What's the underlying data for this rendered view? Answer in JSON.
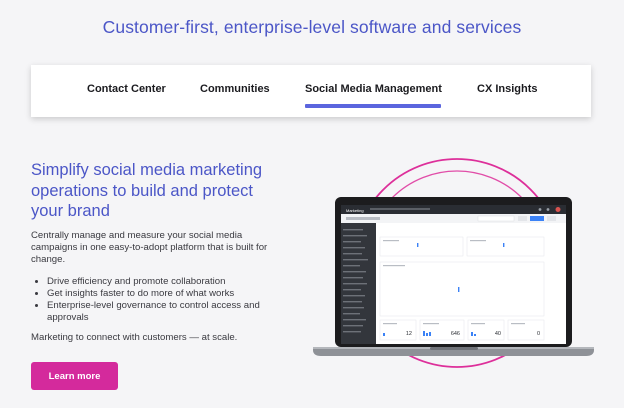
{
  "headline": "Customer-first, enterprise-level software and services",
  "tabs": [
    {
      "label": "Contact Center",
      "active": false
    },
    {
      "label": "Communities",
      "active": false
    },
    {
      "label": "Social Media Management",
      "active": true
    },
    {
      "label": "CX Insights",
      "active": false
    }
  ],
  "content": {
    "subhead_lines": [
      "Simplify social media marketing",
      "operations to build and protect",
      "your brand"
    ],
    "paragraph_lines": [
      "Centrally manage and measure your social media",
      "campaigns in one easy-to-adopt platform that is built for",
      "change."
    ],
    "bullets": [
      "Drive efficiency and promote collaboration",
      "Get insights faster to do more of what works",
      "Enterprise-level governance to control access and",
      "approvals"
    ],
    "tagline": "Marketing to connect with customers — at scale.",
    "cta_label": "Learn more"
  },
  "dashboard": {
    "app_title": "Marketing",
    "metrics": [
      "12",
      "646",
      "40",
      "0"
    ]
  },
  "colors": {
    "accent": "#4b56c7",
    "tab_underline": "#5b65de",
    "cta": "#d42a9c",
    "ring": "#dd2f9a"
  }
}
